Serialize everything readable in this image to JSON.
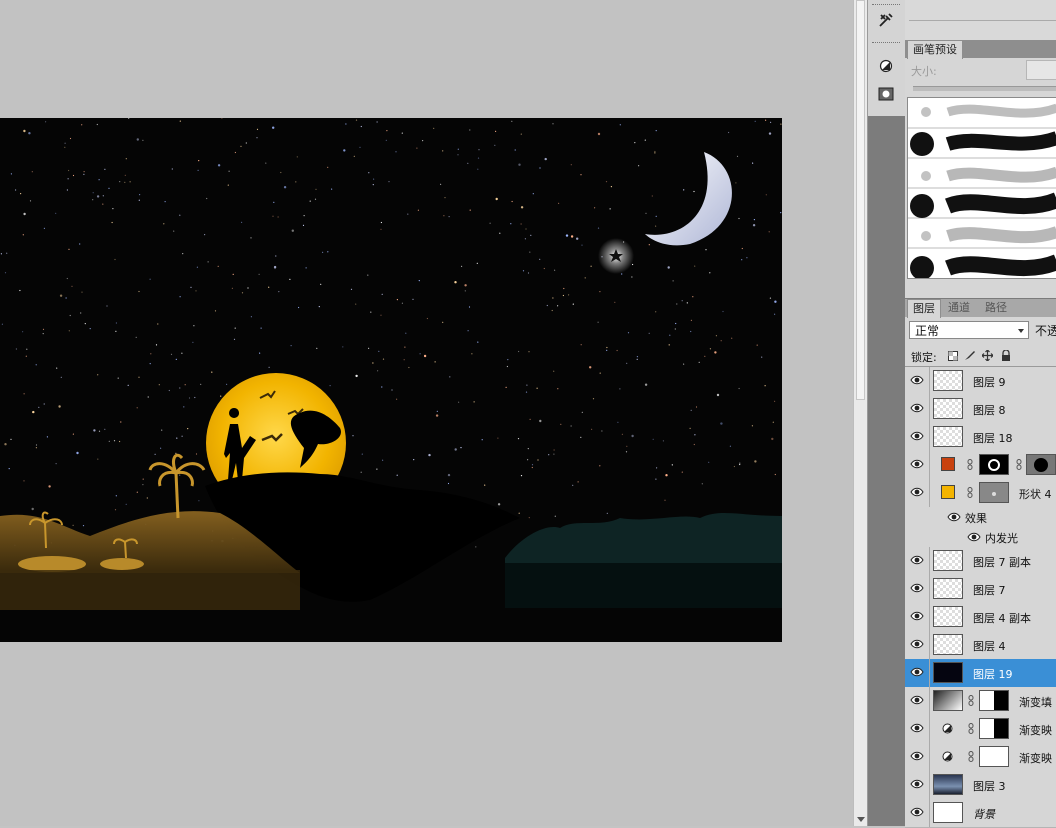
{
  "brushes_panel": {
    "tab_label": "画笔预设",
    "size_label": "大小:",
    "size_value": ""
  },
  "layers_panel": {
    "tabs": [
      {
        "label": "图层",
        "active": true
      },
      {
        "label": "通道",
        "active": false
      },
      {
        "label": "路径",
        "active": false
      }
    ],
    "blend_mode": "正常",
    "opacity_label": "不透",
    "lock_label": "锁定:",
    "lock_icons": [
      "lock-transparent-icon",
      "lock-paint-icon",
      "lock-position-icon",
      "lock-all-icon"
    ],
    "effects_label": "效果",
    "effect_item": "内发光",
    "layers": [
      {
        "name": "图层 9",
        "kind": "raster",
        "thumb": "checker"
      },
      {
        "name": "图层 8",
        "kind": "raster",
        "thumb": "checker"
      },
      {
        "name": "图层 18",
        "kind": "raster",
        "thumb": "checker"
      },
      {
        "name": "",
        "kind": "shape",
        "swatch": "#c8410e"
      },
      {
        "name": "形状 4",
        "kind": "shape",
        "swatch": "#f4b400"
      },
      {
        "name": "图层 7 副本",
        "kind": "raster",
        "thumb": "checker"
      },
      {
        "name": "图层 7",
        "kind": "raster",
        "thumb": "checker"
      },
      {
        "name": "图层 4 副本",
        "kind": "raster",
        "thumb": "checker"
      },
      {
        "name": "图层 4",
        "kind": "raster",
        "thumb": "checker"
      },
      {
        "name": "图层 19",
        "kind": "raster",
        "thumb": "night",
        "selected": true
      },
      {
        "name": "渐变填",
        "kind": "gradient-fill"
      },
      {
        "name": "渐变映",
        "kind": "gradient-map"
      },
      {
        "name": "渐变映",
        "kind": "gradient-map"
      },
      {
        "name": "图层 3",
        "kind": "raster",
        "thumb": "sky"
      },
      {
        "name": "背景",
        "kind": "background",
        "thumb": "white"
      }
    ]
  },
  "colors": {
    "selection": "#3a8fd6",
    "moon_glow": "#f2b400",
    "sky": "#050505"
  }
}
